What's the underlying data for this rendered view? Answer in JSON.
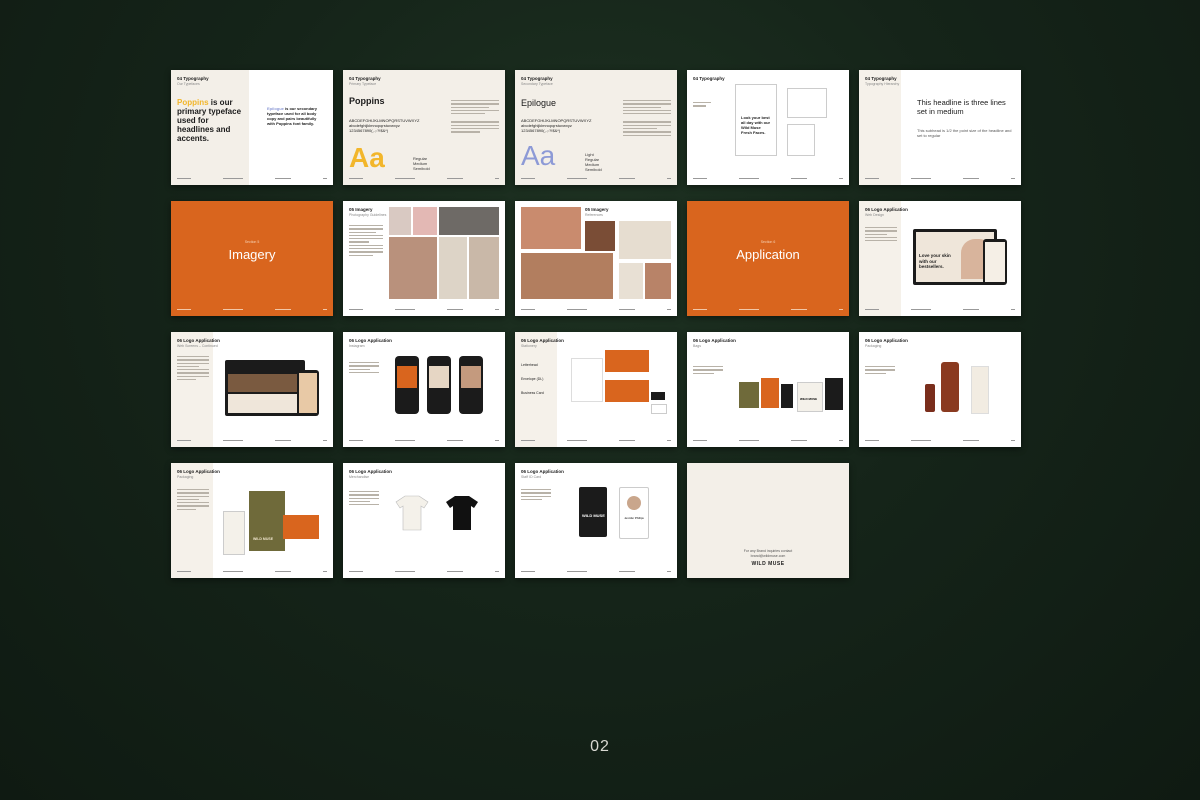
{
  "page": {
    "number": "02"
  },
  "slides": {
    "s1": {
      "heading": "04 Typography",
      "sub": "Our Typefaces",
      "accent": "Poppins",
      "body": " is our primary typeface used for headlines and accents.",
      "secondary_accent": "Epilogue",
      "secondary_body": " is our secondary typeface used for all body copy and pairs beautifully with Poppins font family."
    },
    "s2": {
      "heading": "04 Typography",
      "sub": "Primary Typeface",
      "font": "Poppins",
      "upper": "ABCDEFGHIJKLMNOPQRSTUVWXYZ",
      "lower": "abcdefghijklmnopqrstuvwxyz",
      "nums": "1234567890(,.;:?!$&*)",
      "sample": "Aa",
      "weights": [
        "Regular",
        "Medium",
        "Semibold"
      ]
    },
    "s3": {
      "heading": "04 Typography",
      "sub": "Secondary Typeface",
      "font": "Epilogue",
      "upper": "ABCDEFGHIJKLMNOPQRSTUVWXYZ",
      "lower": "abcdefghijklmnopqrstuvwxyz",
      "nums": "1234567890(,.;:?!$&*)",
      "sample": "Aa",
      "weights": [
        "Light",
        "Regular",
        "Medium",
        "Semibold"
      ]
    },
    "s4": {
      "heading": "04 Typography",
      "card_text": "Look your best all day with our Wild Muse Fresh Faces."
    },
    "s5": {
      "heading": "04 Typography",
      "sub": "Typography Hierarchy",
      "headline": "This headline is three lines set in medium",
      "subhead": "This subhead is 1/2 the point size of the headline and set to regular"
    },
    "s6": {
      "section": "Section 5",
      "title": "Imagery"
    },
    "s7": {
      "heading": "05 Imagery",
      "sub": "Photography Guidelines"
    },
    "s8": {
      "heading": "05 Imagery",
      "sub": "References"
    },
    "s9": {
      "section": "Section 6",
      "title": "Application"
    },
    "s10": {
      "heading": "06 Logo Application",
      "sub": "Web Design",
      "hero": "Love your skin with our bestsellers."
    },
    "s11": {
      "heading": "06 Logo Application",
      "sub": "Web Screens – Continued"
    },
    "s12": {
      "heading": "06 Logo Application",
      "sub": "Instagram"
    },
    "s13": {
      "heading": "06 Logo Application",
      "sub": "Stationery",
      "items": [
        "Letterhead",
        "Envelope (DL)",
        "Business Card"
      ]
    },
    "s14": {
      "heading": "06 Logo Application",
      "sub": "Bags",
      "brand": "WILD MUSE"
    },
    "s15": {
      "heading": "06 Logo Application",
      "sub": "Packaging"
    },
    "s16": {
      "heading": "06 Logo Application",
      "sub": "Packaging",
      "brand": "WILD MUSE"
    },
    "s17": {
      "heading": "06 Logo Application",
      "sub": "Merchandise"
    },
    "s18": {
      "heading": "06 Logo Application",
      "sub": "Staff ID Card",
      "brand": "WILD MUSE",
      "name": "Jennifer Phillips"
    },
    "s19": {
      "contact": "For any Brand inquiries contact",
      "email": "brand@wildmuse.com",
      "brand": "WILD MUSE"
    }
  },
  "colors": {
    "background": "#152419",
    "orange": "#d9651e",
    "olive": "#6f6a3a",
    "yellow": "#f2b62b",
    "lavender": "#8d9ad6"
  }
}
